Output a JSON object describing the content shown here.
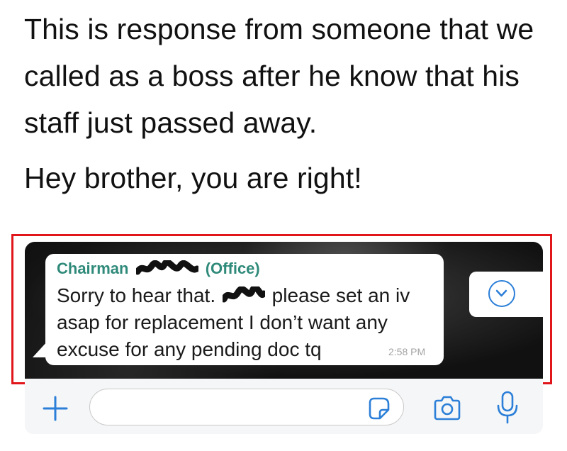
{
  "post": {
    "paragraph1": "This is response from someone that we called as a boss after he know that his staff just passed away.",
    "paragraph2": "Hey brother, you are right!"
  },
  "chat": {
    "sender_prefix": "Chairman",
    "sender_suffix": "(Office)",
    "message_part1": "Sorry to hear that.",
    "message_part2": "please set an iv asap for replacement I don’t want any excuse for any pending doc tq",
    "time": "2:58 PM",
    "colors": {
      "sender": "#2f8a7a",
      "accent": "#2b7fd8",
      "highlight_border": "#e0161b"
    }
  },
  "icons": {
    "scroll_down": "chevron-down-circle-icon",
    "attach": "plus-icon",
    "sticker": "sticker-icon",
    "camera": "camera-icon",
    "mic": "microphone-icon"
  }
}
